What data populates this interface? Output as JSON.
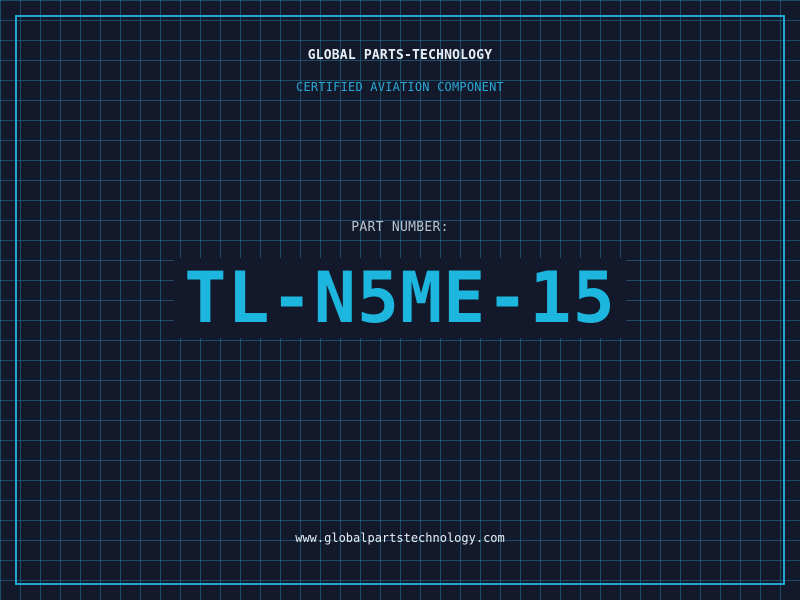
{
  "label": {
    "company": "GLOBAL PARTS-TECHNOLOGY",
    "subtitle": "CERTIFIED AVIATION COMPONENT",
    "part_number_label": "PART NUMBER:",
    "part_number": "TL-N5ME-15",
    "website": "www.globalpartstechnology.com"
  },
  "colors": {
    "background": "#13192b",
    "grid": "#247696",
    "accent": "#1cb6de",
    "frame": "#22a6cf",
    "text": "#e8eef5"
  }
}
